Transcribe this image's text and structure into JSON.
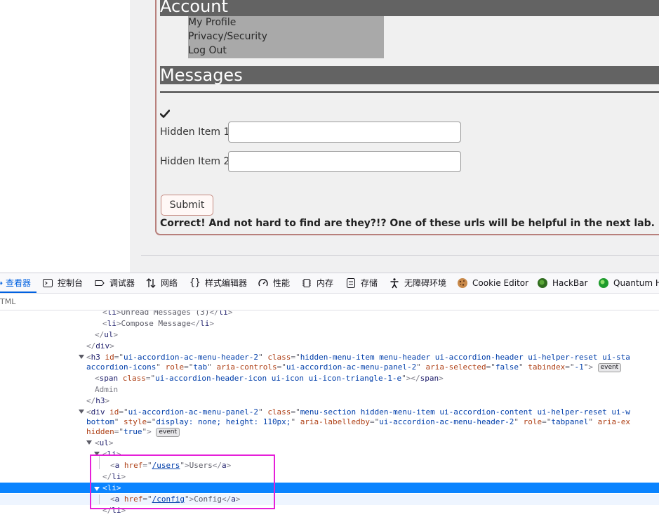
{
  "page": {
    "account": {
      "header": "Account",
      "items": [
        "My Profile",
        "Privacy/Security",
        "Log Out"
      ]
    },
    "messages": {
      "header": "Messages",
      "check_glyph": "✔",
      "fields": [
        {
          "label": "Hidden Item 1",
          "value": ""
        },
        {
          "label": "Hidden Item 2",
          "value": ""
        }
      ],
      "submit_label": "Submit",
      "result_text": "Correct! And not hard to find are they?!? One of these urls will be helpful in the next lab."
    }
  },
  "devtools": {
    "tabs": [
      {
        "label": "查看器",
        "icon": "inspector-icon"
      },
      {
        "label": "控制台",
        "icon": "console-icon"
      },
      {
        "label": "调试器",
        "icon": "debugger-icon"
      },
      {
        "label": "网络",
        "icon": "network-icon"
      },
      {
        "label": "样式编辑器",
        "icon": "style-editor-icon"
      },
      {
        "label": "性能",
        "icon": "performance-icon"
      },
      {
        "label": "内存",
        "icon": "memory-icon"
      },
      {
        "label": "存储",
        "icon": "storage-icon"
      },
      {
        "label": "无障碍环境",
        "icon": "accessibility-icon"
      },
      {
        "label": "Cookie Editor",
        "icon": "cookie-icon"
      },
      {
        "label": "HackBar",
        "icon": "hackbar-icon"
      },
      {
        "label": "Quantum H",
        "icon": "quantum-icon"
      }
    ],
    "breadcrumb": "TML",
    "tree": {
      "l1_text": "Unread Messages (3)",
      "l2_text": "Compose Message",
      "h3_id": "ui-accordion-ac-menu-header-2",
      "h3_class": "hidden-menu-item menu-header ui-accordion-header ui-helper-reset ui-sta",
      "h3_class2": "accordion-icons",
      "h3_role": "tab",
      "h3_controls": "ui-accordion-ac-menu-panel-2",
      "h3_selected": "false",
      "h3_tabindex": "-1",
      "span_class": "ui-accordion-header-icon ui-icon ui-icon-triangle-1-e",
      "admin_text": "Admin",
      "div_id": "ui-accordion-ac-menu-panel-2",
      "div_class": "menu-section hidden-menu-item ui-accordion-content ui-helper-reset ui-w",
      "div_class2": "bottom",
      "div_style": "display: none; height: 110px;",
      "div_labelledby": "ui-accordion-ac-menu-header-2",
      "div_role": "tabpanel",
      "div_hidden": "true",
      "event_badge": "event",
      "link1_href": "/users",
      "link1_text": "Users",
      "link2_href": "/config",
      "link2_text": "Config"
    }
  }
}
